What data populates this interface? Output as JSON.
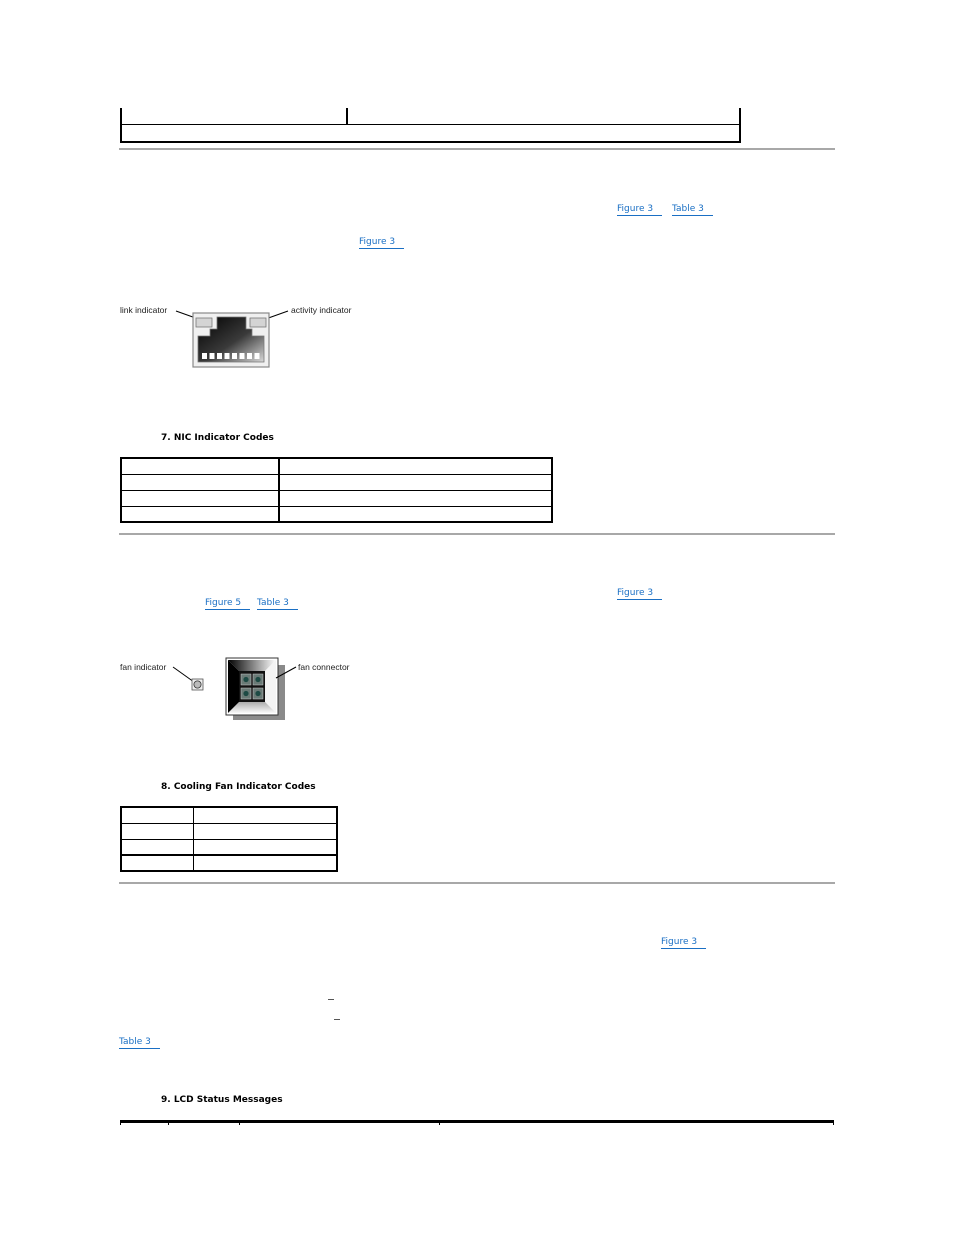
{
  "top_table": {
    "rows": [
      [
        "",
        ""
      ],
      [
        ""
      ]
    ]
  },
  "nic_section": {
    "links_para1": [
      "Figure 3",
      "Table 3"
    ],
    "links_para2": [
      "Figure 3"
    ],
    "figure": {
      "labels": {
        "link": "link indicator",
        "activity": "activity indicator"
      }
    },
    "table_caption": "7. NIC Indicator Codes",
    "table_rows": [
      [
        "",
        ""
      ],
      [
        "",
        ""
      ],
      [
        "",
        ""
      ],
      [
        "",
        ""
      ]
    ]
  },
  "fan_section": {
    "links_para1": [
      "Figure 3"
    ],
    "links_para2": [
      "Figure 5",
      "Table 3"
    ],
    "figure": {
      "labels": {
        "indicator": "fan indicator",
        "connector": "fan connector"
      }
    },
    "table_caption": "8. Cooling Fan Indicator Codes",
    "table_rows": [
      [
        "",
        ""
      ],
      [
        "",
        ""
      ],
      [
        "",
        ""
      ],
      [
        "",
        ""
      ]
    ]
  },
  "lcd_section": {
    "links_para1": [
      "Figure 3"
    ],
    "links_para2": [
      "Table 3"
    ],
    "table_caption": "9. LCD Status Messages"
  }
}
